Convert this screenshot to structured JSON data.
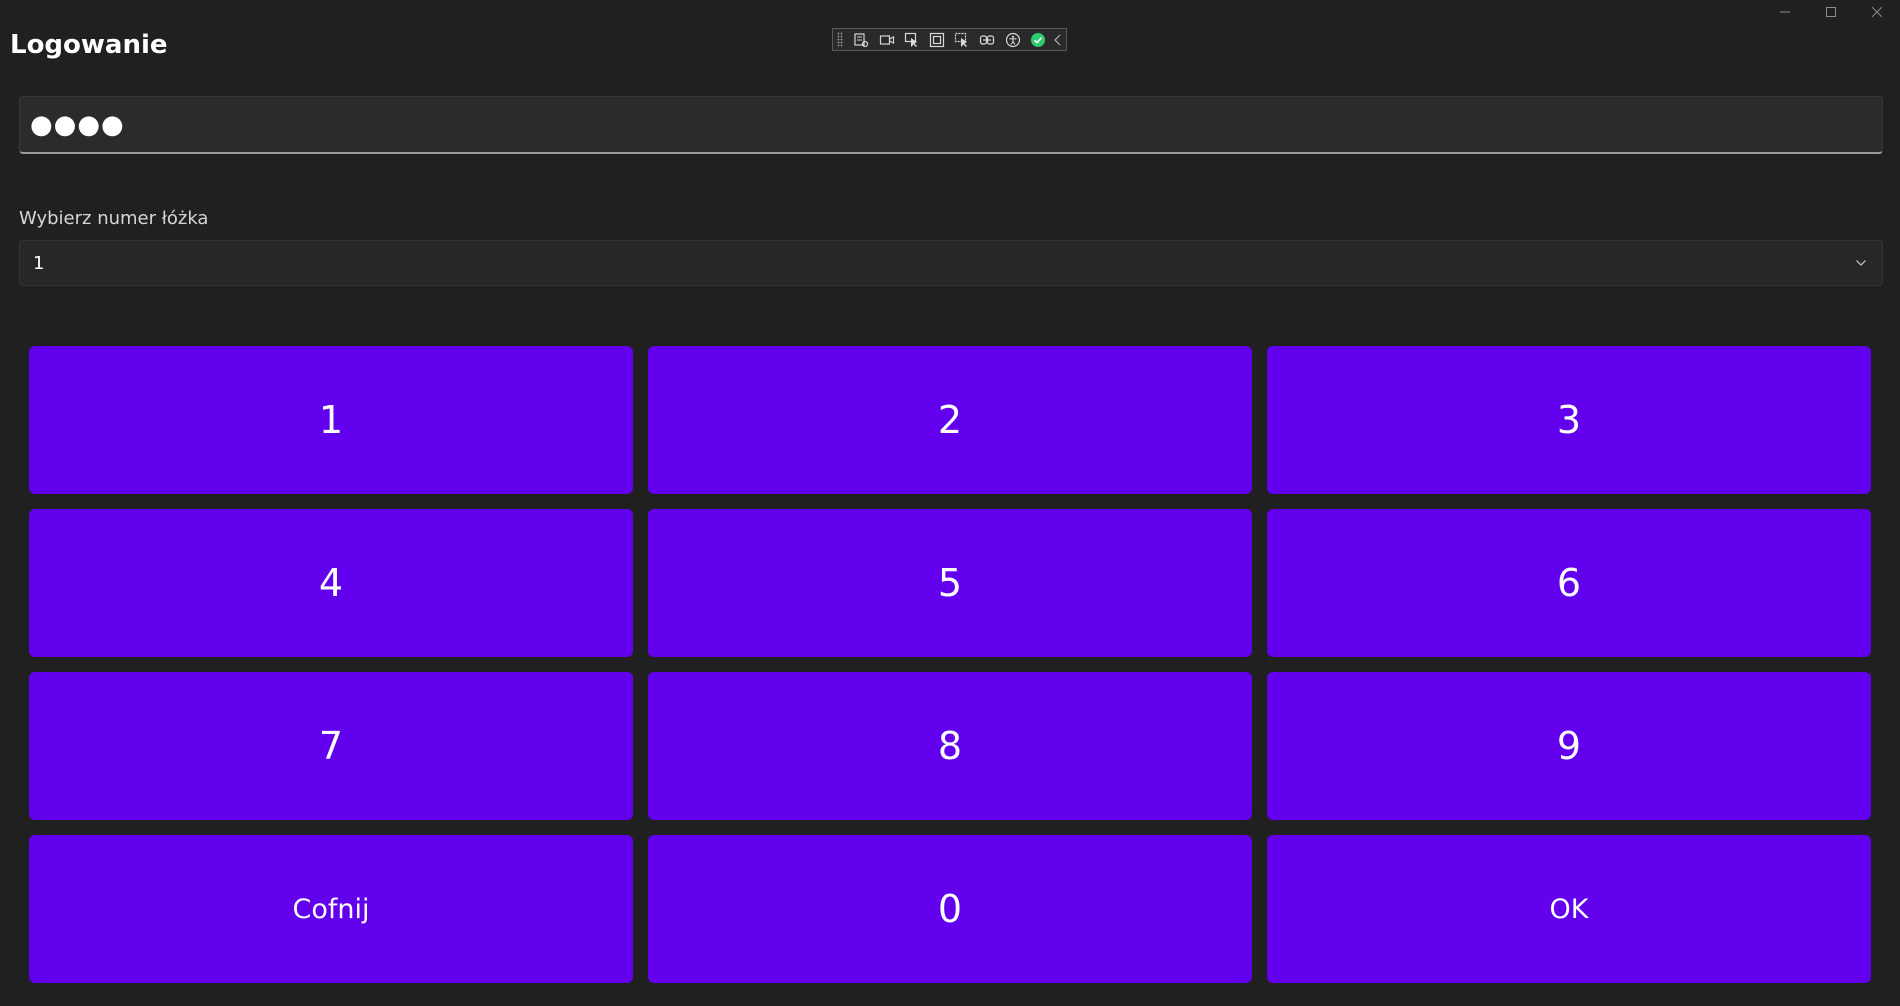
{
  "window": {
    "title": "Logowanie",
    "caption_buttons": {
      "minimize": "minimize-icon",
      "maximize": "maximize-icon",
      "close": "close-icon"
    }
  },
  "debug_toolbar": {
    "icons": [
      "live-visual-tree-icon",
      "video-record-icon",
      "select-element-icon",
      "display-layout-adorners-icon",
      "track-focus-icon",
      "binding-failures-icon",
      "accessibility-checker-icon",
      "hot-reload-status-icon",
      "collapse-toolbar-icon"
    ]
  },
  "pin": {
    "value": "●●●●"
  },
  "bed_select": {
    "label": "Wybierz numer łóżka",
    "selected": "1"
  },
  "keypad": {
    "keys": [
      "1",
      "2",
      "3",
      "4",
      "5",
      "6",
      "7",
      "8",
      "9",
      "Cofnij",
      "0",
      "OK"
    ]
  },
  "colors": {
    "background": "#202020",
    "key": "#6200ee",
    "text": "#ffffff",
    "status_ok": "#2ecc71"
  }
}
